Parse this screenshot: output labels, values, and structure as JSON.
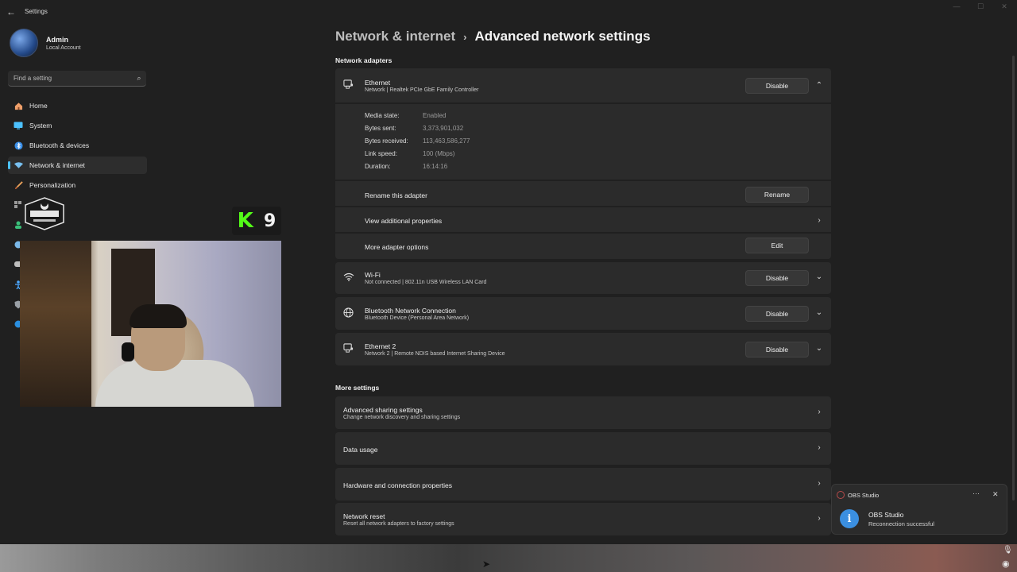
{
  "window": {
    "title": "Settings",
    "back_icon": "arrow-left-icon"
  },
  "profile": {
    "name": "Admin",
    "account_type": "Local Account"
  },
  "search": {
    "placeholder": "Find a setting"
  },
  "nav": {
    "items": [
      {
        "label": "Home",
        "icon": "home-icon",
        "color": "#f0a06a"
      },
      {
        "label": "System",
        "icon": "monitor-icon",
        "color": "#4cc2ff"
      },
      {
        "label": "Bluetooth & devices",
        "icon": "bluetooth-icon",
        "color": "#3a8fe8"
      },
      {
        "label": "Network & internet",
        "icon": "wifi-diamond-icon",
        "color": "#78c0f0",
        "active": true
      },
      {
        "label": "Personalization",
        "icon": "brush-icon",
        "color": "#e8a05a"
      }
    ]
  },
  "overlay": {
    "badge_letter": "K",
    "badge_number": "9",
    "brand_color": "#53fc18"
  },
  "breadcrumb": {
    "parent": "Network & internet",
    "separator": "›",
    "current": "Advanced network settings"
  },
  "sections": {
    "adapters": "Network adapters",
    "more": "More settings"
  },
  "ethernet": {
    "name": "Ethernet",
    "description": "Network | Realtek PCIe GbE Family Controller",
    "button": "Disable",
    "properties": [
      {
        "key": "Media state:",
        "value": "Enabled"
      },
      {
        "key": "Bytes sent:",
        "value": "3,373,901,032"
      },
      {
        "key": "Bytes received:",
        "value": "113,463,586,277"
      },
      {
        "key": "Link speed:",
        "value": "100 (Mbps)"
      },
      {
        "key": "Duration:",
        "value": "16:14:16"
      }
    ],
    "rename_label": "Rename this adapter",
    "rename_button": "Rename",
    "view_props_label": "View additional properties",
    "more_options_label": "More adapter options",
    "edit_button": "Edit"
  },
  "adapters": [
    {
      "name": "Wi-Fi",
      "description": "Not connected | 802.11n USB Wireless LAN Card",
      "button": "Disable",
      "icon": "wifi-icon"
    },
    {
      "name": "Bluetooth Network Connection",
      "description": "Bluetooth Device (Personal Area Network)",
      "button": "Disable",
      "icon": "globe-icon"
    },
    {
      "name": "Ethernet 2",
      "description": "Network 2 | Remote NDIS based Internet Sharing Device",
      "button": "Disable",
      "icon": "ethernet-icon"
    }
  ],
  "more_settings": [
    {
      "title": "Advanced sharing settings",
      "subtitle": "Change network discovery and sharing settings"
    },
    {
      "title": "Data usage",
      "subtitle": ""
    },
    {
      "title": "Hardware and connection properties",
      "subtitle": ""
    },
    {
      "title": "Network reset",
      "subtitle": "Reset all network adapters to factory settings"
    }
  ],
  "toast": {
    "app": "OBS Studio",
    "title": "OBS Studio",
    "message": "Reconnection successful",
    "more": "···",
    "close": "✕",
    "info_glyph": "i"
  },
  "colors": {
    "accent": "#4cc2ff",
    "background": "#202020",
    "card": "#2b2b2b"
  }
}
